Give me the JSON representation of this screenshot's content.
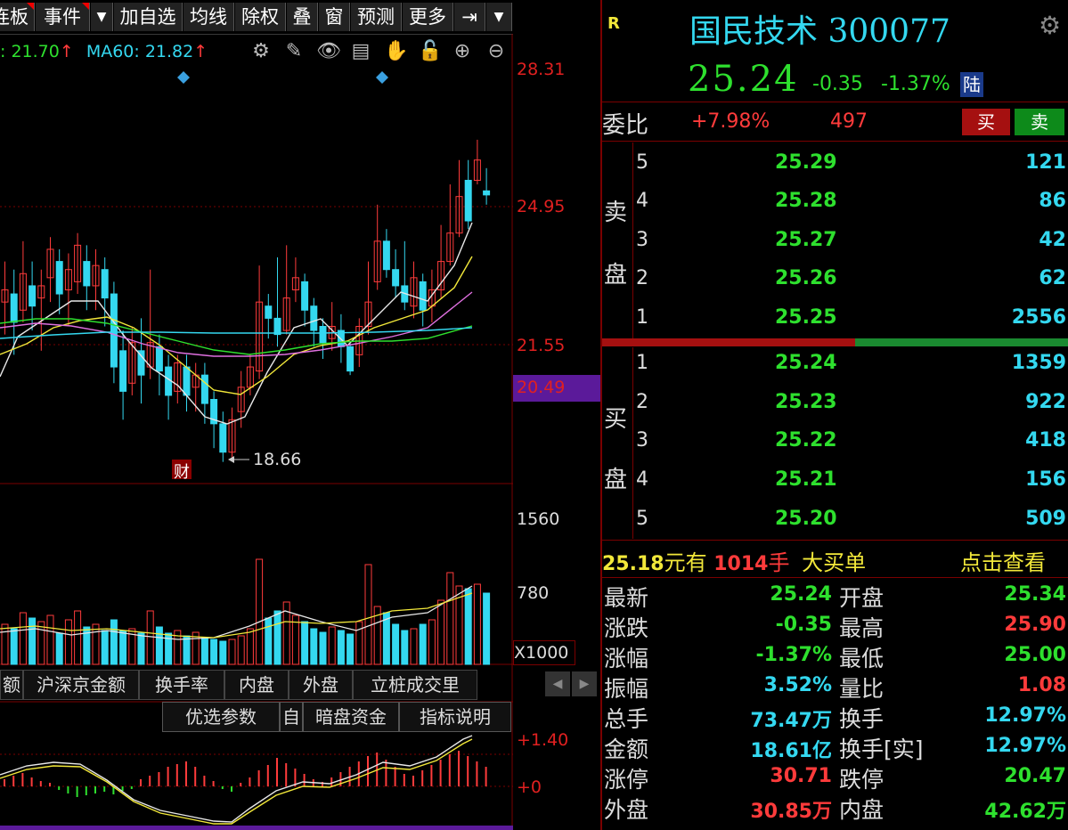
{
  "toolbar": {
    "items": [
      "连板",
      "事件",
      "▼",
      "加自选",
      "均线",
      "除权",
      "叠",
      "窗",
      "预测",
      "更多",
      "⇥",
      "▼"
    ]
  },
  "ma_legend": {
    "ma_a": ": 21.70",
    "ma_a_arrow": "↑",
    "ma60": "MA60: 21.82",
    "ma60_arrow": "↑"
  },
  "price_axis": {
    "top": "28.31",
    "mid": "24.95",
    "low": "21.55",
    "current": "20.49",
    "vol_top": "1560",
    "vol_mid": "780",
    "vol_unit": "X1000",
    "macd_top": "+1.40",
    "macd_zero": "+0"
  },
  "chart_annotations": {
    "low_price": "18.66",
    "finance_marker": "财"
  },
  "indicator_tabs": [
    "额",
    "沪深京金额",
    "换手率",
    "内盘",
    "外盘",
    "立桩成交里"
  ],
  "bottom_tabs": [
    "优选参数",
    "自",
    "暗盘资金",
    "指标说明"
  ],
  "quote": {
    "badge": "R",
    "name": "国民技术",
    "code": "300077",
    "price": "25.24",
    "change": "-0.35",
    "change_pct": "-1.37%",
    "market_badge": "陆",
    "weibi_label": "委比",
    "weibi_value": "+7.98%",
    "weicha_value": "497",
    "buy_btn": "买",
    "sell_btn": "卖"
  },
  "orderbook": {
    "sell_label": [
      "卖",
      "盘"
    ],
    "buy_label": [
      "买",
      "盘"
    ],
    "sell": [
      {
        "level": "5",
        "price": "25.29",
        "vol": "121"
      },
      {
        "level": "4",
        "price": "25.28",
        "vol": "86"
      },
      {
        "level": "3",
        "price": "25.27",
        "vol": "42"
      },
      {
        "level": "2",
        "price": "25.26",
        "vol": "62"
      },
      {
        "level": "1",
        "price": "25.25",
        "vol": "2556"
      }
    ],
    "buy": [
      {
        "level": "1",
        "price": "25.24",
        "vol": "1359"
      },
      {
        "level": "2",
        "price": "25.23",
        "vol": "922"
      },
      {
        "level": "3",
        "price": "25.22",
        "vol": "418"
      },
      {
        "level": "4",
        "price": "25.21",
        "vol": "156"
      },
      {
        "level": "5",
        "price": "25.20",
        "vol": "509"
      }
    ]
  },
  "big_order": {
    "price": "25.18",
    "text1": "元有",
    "qty": "1014",
    "text2": "手",
    "label": "大买单",
    "link": "点击查看"
  },
  "stats": [
    {
      "l1": "最新",
      "v1": "25.24",
      "c1": "g",
      "l2": "开盘",
      "v2": "25.34",
      "c2": "g"
    },
    {
      "l1": "涨跌",
      "v1": "-0.35",
      "c1": "g",
      "l2": "最高",
      "v2": "25.90",
      "c2": "r"
    },
    {
      "l1": "涨幅",
      "v1": "-1.37%",
      "c1": "g",
      "l2": "最低",
      "v2": "25.00",
      "c2": "g"
    },
    {
      "l1": "振幅",
      "v1": "3.52%",
      "c1": "c",
      "l2": "量比",
      "v2": "1.08",
      "c2": "r"
    },
    {
      "l1": "总手",
      "v1": "73.47万",
      "c1": "c",
      "l2": "换手",
      "v2": "12.97%",
      "c2": "c"
    },
    {
      "l1": "金额",
      "v1": "18.61亿",
      "c1": "c",
      "l2": "换手[实]",
      "v2": "12.97%",
      "c2": "c"
    },
    {
      "l1": "涨停",
      "v1": "30.71",
      "c1": "r",
      "l2": "跌停",
      "v2": "20.47",
      "c2": "g"
    },
    {
      "l1": "外盘",
      "v1": "30.85万",
      "c1": "r",
      "l2": "内盘",
      "v2": "42.62万",
      "c2": "g"
    }
  ],
  "colors": {
    "up": "#ff3b3b",
    "down": "#34d8f0",
    "green": "#2ee02e",
    "cyan": "#34d8f0",
    "yellow": "#f2e83a",
    "purple": "#5b1a9a"
  }
}
